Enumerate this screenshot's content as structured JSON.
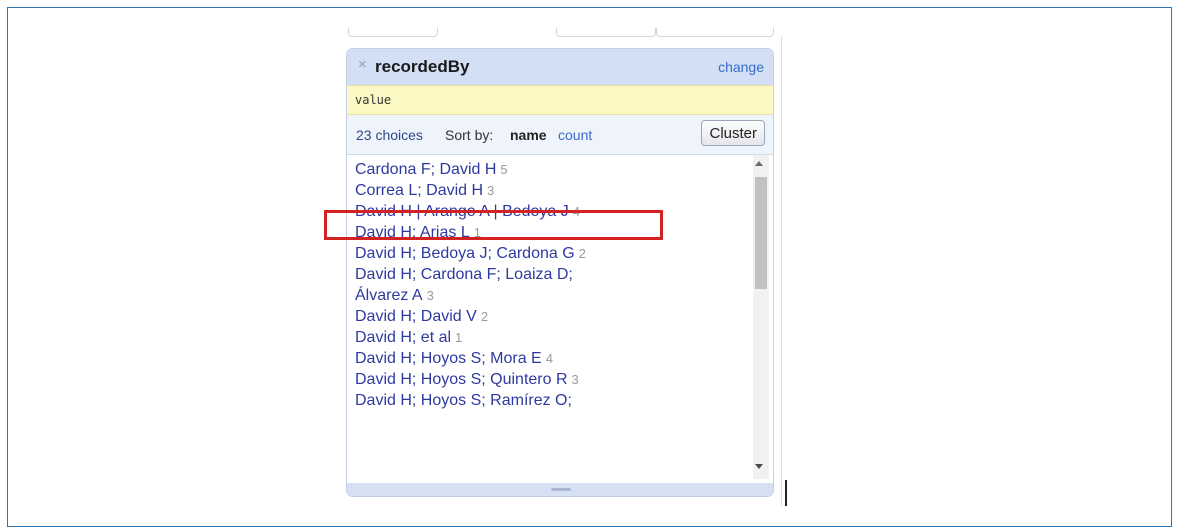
{
  "facet": {
    "title": "recordedBy",
    "change_label": "change",
    "close_icon": "close-icon",
    "expression": "value",
    "choices_count": "23 choices",
    "sort_by_label": "Sort by:",
    "sort_name_label": "name",
    "sort_count_label": "count",
    "cluster_label": "Cluster",
    "choices": [
      {
        "name": "Cardona F; David H",
        "count": "5"
      },
      {
        "name": "Correa L; David H",
        "count": "3"
      },
      {
        "name": "David H | Arango A | Bedoya J",
        "count": "4"
      },
      {
        "name": "David H; Arias L",
        "count": "1"
      },
      {
        "name": "David H; Bedoya J; Cardona G",
        "count": "2"
      },
      {
        "name": "David H; Cardona F; Loaiza D; Álvarez A",
        "count": "3"
      },
      {
        "name": "David H; David V",
        "count": "2"
      },
      {
        "name": "David H; et al",
        "count": "1"
      },
      {
        "name": "David H; Hoyos S; Mora E",
        "count": "4"
      },
      {
        "name": "David H; Hoyos S; Quintero R",
        "count": "3"
      },
      {
        "name": "David H; Hoyos S; Ramírez O;",
        "count": ""
      }
    ]
  },
  "highlight_color": "#d42222",
  "accent_color": "#2e3a9f"
}
